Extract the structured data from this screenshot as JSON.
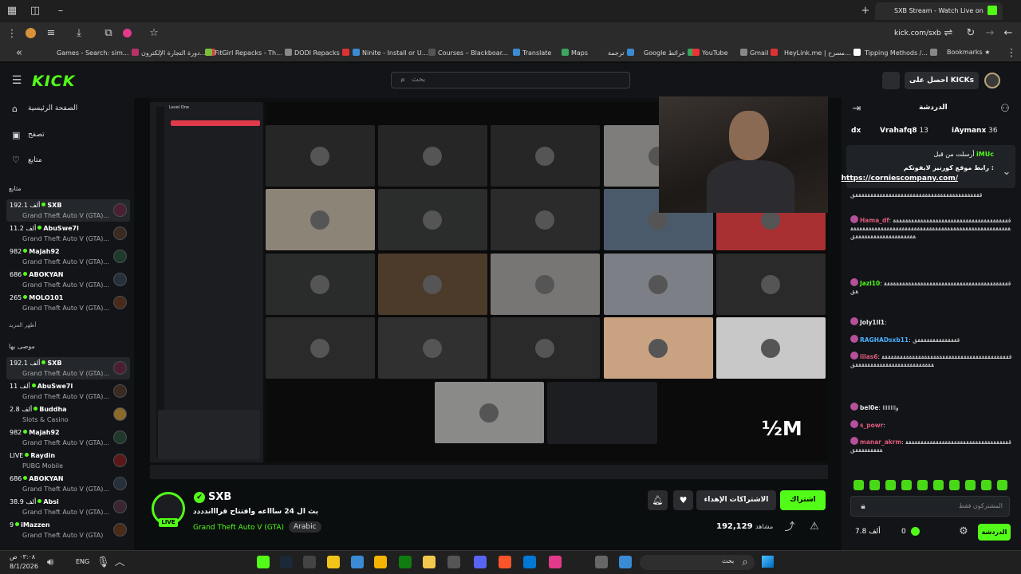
{
  "browser": {
    "tab_title": "SXB Stream - Watch Live on",
    "url": "kick.com/sxb",
    "bookmarks": [
      "Games - Search: sim...",
      "دورة التجارة الإلكترون...",
      "FitGirl Repacks - Th...",
      "DODI Repacks",
      "Ninite - Install or U...",
      "Courses – Blackboar...",
      "Translate",
      "Maps",
      "ترجمة",
      "Google خرائط",
      "YouTube",
      "Gmail",
      "HeyLink.me | مسرح...",
      "Tipping Methods /...",
      "Bookmarks"
    ]
  },
  "header": {
    "logo": "KICK",
    "search_placeholder": "بحث",
    "kicks_button": "احصل على KICKs"
  },
  "sidebar": {
    "nav": [
      {
        "label": "الصفحة الرئيسية",
        "icon": "home-icon"
      },
      {
        "label": "تصفح",
        "icon": "browse-icon"
      },
      {
        "label": "متابع",
        "icon": "heart-icon"
      }
    ],
    "following_title": "متابع",
    "following": [
      {
        "viewers": "192.1 ألف",
        "name": "SXB",
        "game": "Grand Theft Auto V (GTA)...",
        "active": true
      },
      {
        "viewers": "11.2 ألف",
        "name": "AbuSwe7l",
        "game": "Grand Theft Auto V (GTA)...",
        "active": false
      },
      {
        "viewers": "982",
        "name": "Majah92",
        "game": "Grand Theft Auto V (GTA)...",
        "active": false
      },
      {
        "viewers": "686",
        "name": "ABOKYAN",
        "game": "Grand Theft Auto V (GTA)...",
        "active": false
      },
      {
        "viewers": "265",
        "name": "MOLO101",
        "game": "Grand Theft Auto V (GTA)...",
        "active": false
      }
    ],
    "show_more": "أظهر المزيد",
    "recommended_title": "موصى بها",
    "recommended": [
      {
        "viewers": "192.1 ألف",
        "name": "SXB",
        "game": "Grand Theft Auto V (GTA)...",
        "active": true
      },
      {
        "viewers": "11 ألف",
        "name": "AbuSwe7l",
        "game": "Grand Theft Auto V (GTA)...",
        "active": false
      },
      {
        "viewers": "2.8 ألف",
        "name": "Buddha",
        "game": "Slots & Casino",
        "active": false
      },
      {
        "viewers": "982",
        "name": "Majah92",
        "game": "Grand Theft Auto V (GTA)...",
        "active": false
      },
      {
        "viewers": "LIVE",
        "name": "Raydin",
        "game": "PUBG Mobile",
        "active": false
      },
      {
        "viewers": "686",
        "name": "ABOKYAN",
        "game": "Grand Theft Auto V (GTA)...",
        "active": false
      },
      {
        "viewers": "38.9 ألف",
        "name": "Absi",
        "game": "Grand Theft Auto V (GTA)...",
        "active": false
      },
      {
        "viewers": "9",
        "name": "iMazzen",
        "game": "Grand Theft Auto V (GTA)",
        "active": false
      }
    ]
  },
  "video": {
    "overlay_text": "½M",
    "discord_server": "Level One"
  },
  "stream": {
    "name": "SXB",
    "live": "LIVE",
    "title": "بث ال 24 ساااعه وافتتاح قراااندددد",
    "category": "Grand Theft Auto V (GTA)",
    "tag": "Arabic",
    "viewers": "192,129",
    "viewers_label": "مشاهد",
    "subscribe": "اشتراك",
    "gift_subs": "الاشتراكات الإهداء"
  },
  "chat": {
    "title": "الدردشة",
    "top_gifters": [
      {
        "name": "iAymanx",
        "count": "36"
      },
      {
        "name": "Vrahafq8",
        "count": "13"
      },
      {
        "name": "dx",
        "count": ""
      }
    ],
    "pinned": {
      "author": "iMUc",
      "sent_by": "أرسلت من قبل",
      "text": "رابط موقع كورنيز لايفوتكم :",
      "link": "https://corniescompany.com/"
    },
    "messages": [
      {
        "user": "",
        "text": "ققققققققققققققققققققققققققققققققققققققققققق"
      },
      {
        "user": "Hama_df",
        "text": "ققققققققققققققققققققققققققققققققققققققققققققققققققققققققققققققققققققققققققققققققققققققققققققققققققققققققققققققققق"
      },
      {
        "user": "Jazi10",
        "text": "قققققققققققققققققققققققققققققققققققققققققققق"
      },
      {
        "user": "Joly1ll1",
        "text": ""
      },
      {
        "user": "RAGHADsxb11",
        "text": "ققققققققققققققق"
      },
      {
        "user": "lilas6",
        "text": "قققققققققققققققققققققققققققققققققققققققققققققققققققققققققققققققققققققق"
      },
      {
        "user": "bel0e",
        "text": "واااااااا"
      },
      {
        "user": "s_powr",
        "text": ""
      },
      {
        "user": "manar_akrm",
        "text": "ققققققققققققققققققققققققققققققققققققققققققققق"
      }
    ],
    "input_placeholder": "المشتركون فقط",
    "send": "الدردشة",
    "points": "0",
    "kicks": "7.8 ألف"
  },
  "taskbar": {
    "search": "بحث",
    "lang": "ENG",
    "time": "٠٣:٠٨ ص",
    "date": "8/1/2026"
  }
}
